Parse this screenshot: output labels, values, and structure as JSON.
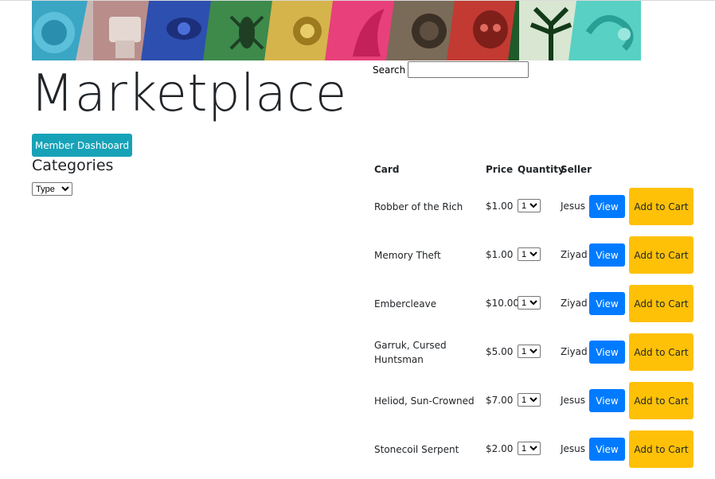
{
  "header": {
    "banner_colors": [
      "#3aa6c4",
      "#b98e8a",
      "#2d4fb0",
      "#3d8a4b",
      "#d6b44c",
      "#e8407a",
      "#7a6a58",
      "#c33a32",
      "#1f5a2a",
      "#58d0c4"
    ]
  },
  "search": {
    "label": "Search",
    "value": "",
    "placeholder": ""
  },
  "page": {
    "title": "Marketplace",
    "dashboard_button": "Member Dashboard"
  },
  "categories": {
    "title": "Categories",
    "select_value": "Type"
  },
  "table": {
    "headers": {
      "card": "Card",
      "price": "Price",
      "quantity": "Quantity",
      "seller": "Seller"
    },
    "rows": [
      {
        "card": "Robber of the Rich",
        "price": "$1.00",
        "qty": "1",
        "seller": "Jesus",
        "view": "View",
        "cart": "Add to Cart"
      },
      {
        "card": "Memory Theft",
        "price": "$1.00",
        "qty": "1",
        "seller": "Ziyad",
        "view": "View",
        "cart": "Add to Cart"
      },
      {
        "card": "Embercleave",
        "price": "$10.00",
        "qty": "1",
        "seller": "Ziyad",
        "view": "View",
        "cart": "Add to Cart"
      },
      {
        "card": "Garruk, Cursed Huntsman",
        "price": "$5.00",
        "qty": "1",
        "seller": "Ziyad",
        "view": "View",
        "cart": "Add to Cart"
      },
      {
        "card": "Heliod, Sun-Crowned",
        "price": "$7.00",
        "qty": "1",
        "seller": "Jesus",
        "view": "View",
        "cart": "Add to Cart"
      },
      {
        "card": "Stonecoil Serpent",
        "price": "$2.00",
        "qty": "1",
        "seller": "Jesus",
        "view": "View",
        "cart": "Add to Cart"
      }
    ]
  },
  "colors": {
    "dashboard_button": "#17a2b8",
    "view_button": "#007bff",
    "cart_button": "#ffc107"
  }
}
